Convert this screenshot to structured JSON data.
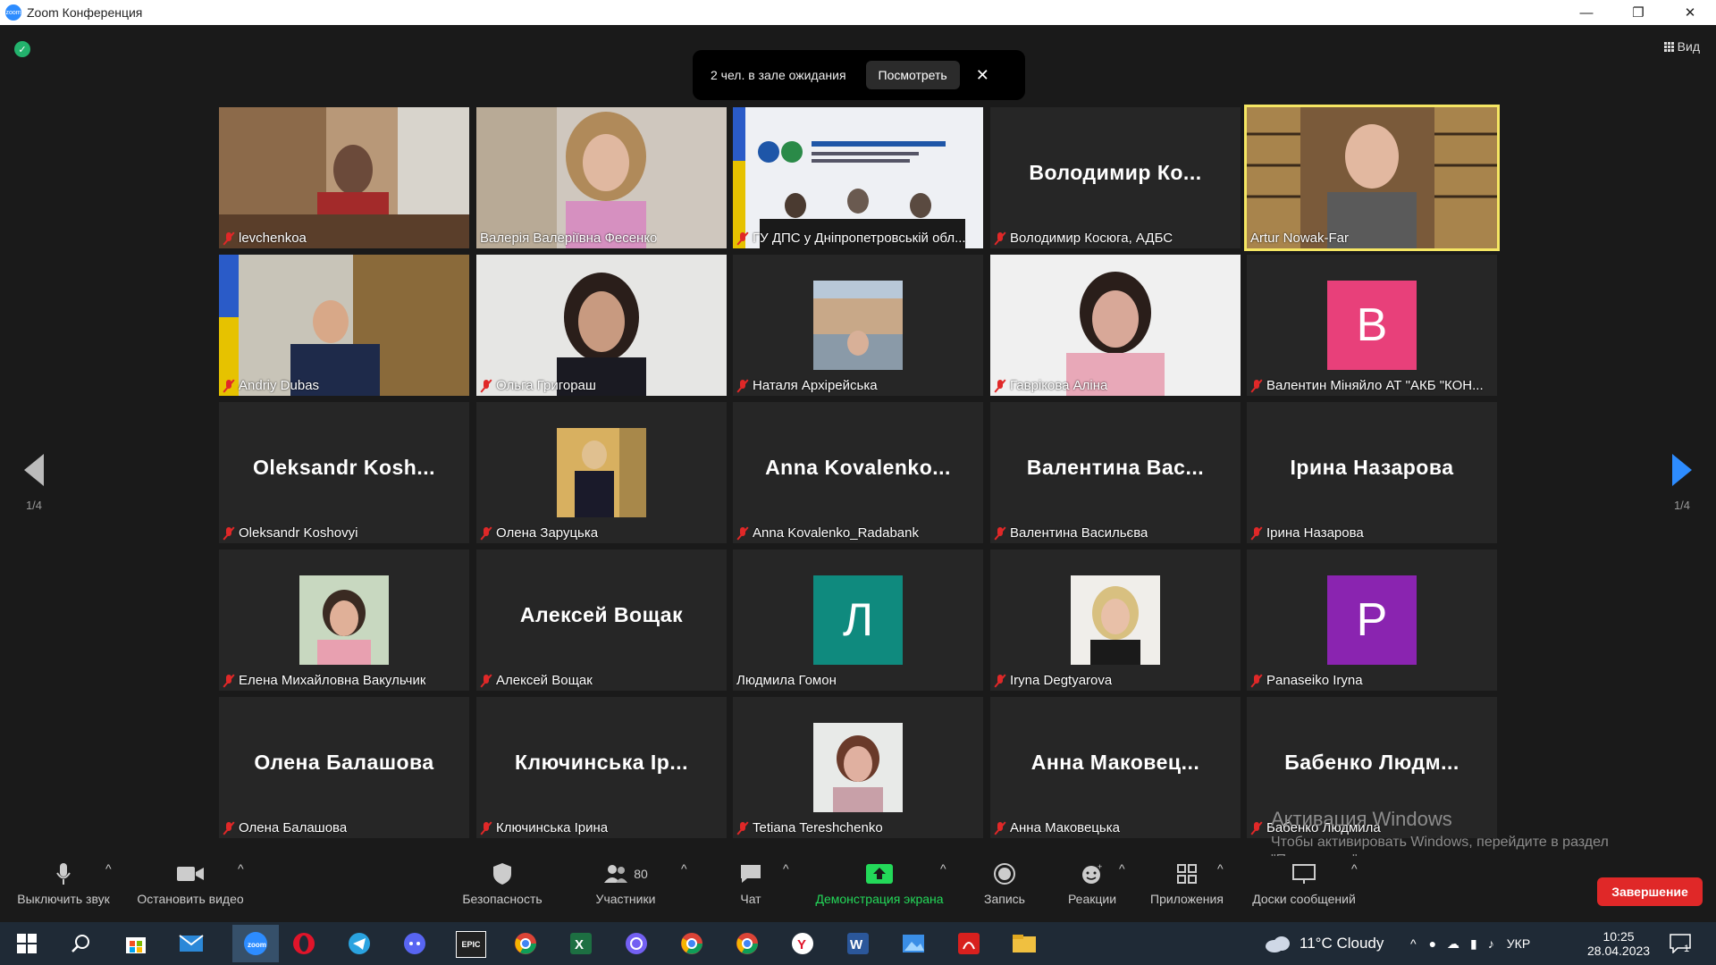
{
  "window": {
    "title": "Zoom Конференция",
    "app_icon_text": "zoom"
  },
  "top": {
    "view_label": "Вид"
  },
  "waiting_room": {
    "text": "2 чел. в зале ожидания",
    "view_button": "Посмотреть"
  },
  "pager": {
    "left": "1/4",
    "right": "1/4"
  },
  "tiles": [
    {
      "name": "levchenkoa",
      "big": ""
    },
    {
      "name": "Валерія Валеріївна Фесенко",
      "big": ""
    },
    {
      "name": "ГУ ДПС у Дніпропетровській обл...",
      "big": ""
    },
    {
      "name": "Володимир Косюга, АДБС",
      "big": "Володимир Ко..."
    },
    {
      "name": "Artur Nowak-Far",
      "big": ""
    },
    {
      "name": "Andriy Dubas",
      "big": ""
    },
    {
      "name": "Ольга Григораш",
      "big": ""
    },
    {
      "name": "Наталя Архірейська",
      "big": ""
    },
    {
      "name": "Гаврікова Аліна",
      "big": ""
    },
    {
      "name": "Валентин Міняйло АТ \"АКБ \"КОН...",
      "big": "",
      "avatar": "В"
    },
    {
      "name": "Oleksandr Koshovyi",
      "big": "Oleksandr Kosh..."
    },
    {
      "name": "Олена Заруцька",
      "big": ""
    },
    {
      "name": "Anna Kovalenko_Radabank",
      "big": "Anna Kovalenko..."
    },
    {
      "name": "Валентина Васильєва",
      "big": "Валентина Вас..."
    },
    {
      "name": "Ірина Назарова",
      "big": "Ірина Назарова"
    },
    {
      "name": "Елена Михайловна Вакульчик",
      "big": ""
    },
    {
      "name": "Алексей Вощак",
      "big": "Алексей Вощак"
    },
    {
      "name": "Людмила Гомон",
      "big": "",
      "avatar": "Л"
    },
    {
      "name": "Iryna Degtyarova",
      "big": ""
    },
    {
      "name": "Panaseiko Iryna",
      "big": "",
      "avatar": "P"
    },
    {
      "name": "Олена Балашова",
      "big": "Олена Балашова"
    },
    {
      "name": "Ключинська Ірина",
      "big": "Ключинська Ір..."
    },
    {
      "name": "Tetiana Tereshchenko",
      "big": ""
    },
    {
      "name": "Анна Маковецька",
      "big": "Анна Маковец..."
    },
    {
      "name": "Бабенко Людмила",
      "big": "Бабенко Людм..."
    }
  ],
  "toolbar": {
    "mute": "Выключить звук",
    "video": "Остановить видео",
    "security": "Безопасность",
    "participants": "Участники",
    "participants_count": "80",
    "chat": "Чат",
    "share": "Демонстрация экрана",
    "record": "Запись",
    "reactions": "Реакции",
    "apps": "Приложения",
    "whiteboards": "Доски сообщений",
    "end": "Завершение"
  },
  "watermark": {
    "line1": "Активация Windows",
    "line2": "Чтобы активировать Windows, перейдите в раздел",
    "line3": "\"Параметры\"."
  },
  "taskbar": {
    "epic_label": "EPIC",
    "weather": "11°C  Cloudy",
    "lang": "УКР",
    "time": "10:25",
    "date": "28.04.2023",
    "notif_count": "1"
  },
  "colors": {
    "accent": "#2d8cff",
    "share_green": "#23d959",
    "end_red": "#e02828",
    "active_speaker": "#f5e663",
    "avatar_pink": "#e8407a",
    "avatar_teal": "#0f8a7e",
    "avatar_purple": "#8a24b0"
  }
}
